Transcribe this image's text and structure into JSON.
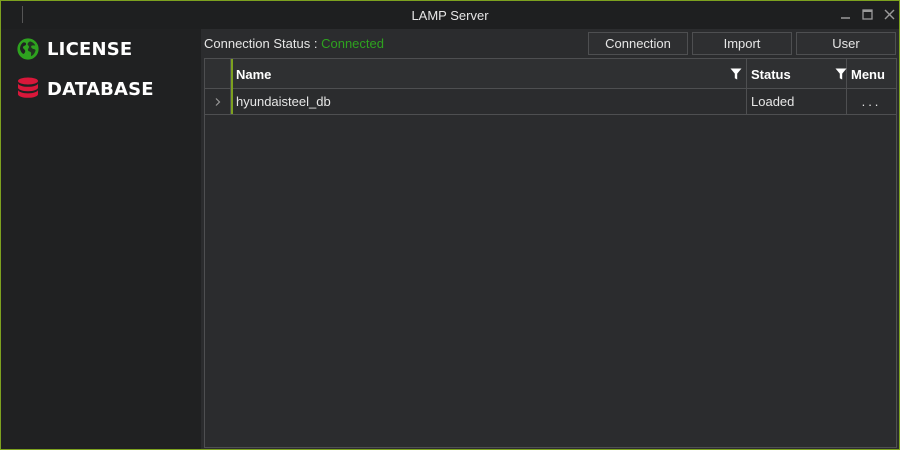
{
  "window": {
    "title": "LAMP Server",
    "controls": {
      "minimize": "minimize-icon",
      "maximize": "maximize-icon",
      "close": "close-icon"
    }
  },
  "sidebar": {
    "items": [
      {
        "label": "LICENSE",
        "icon": "globe-icon",
        "icon_color": "#2ea21f"
      },
      {
        "label": "DATABASE",
        "icon": "database-icon",
        "icon_color": "#d9173a"
      }
    ]
  },
  "connection": {
    "label": "Connection Status :",
    "value": "Connected",
    "value_color": "#2ea21f"
  },
  "toolbar": {
    "connection_label": "Connection",
    "import_label": "Import",
    "user_label": "User"
  },
  "table": {
    "columns": [
      {
        "label": "Name",
        "filter_icon": "filter-icon"
      },
      {
        "label": "Status",
        "filter_icon": "filter-icon"
      },
      {
        "label": "Menu"
      }
    ],
    "rows": [
      {
        "expand_icon": "chevron-right-icon",
        "name": "hyundaisteel_db",
        "status": "Loaded",
        "menu": "..."
      }
    ]
  },
  "colors": {
    "accent": "#7da11f",
    "connected": "#2ea21f",
    "database_icon": "#d9173a"
  }
}
